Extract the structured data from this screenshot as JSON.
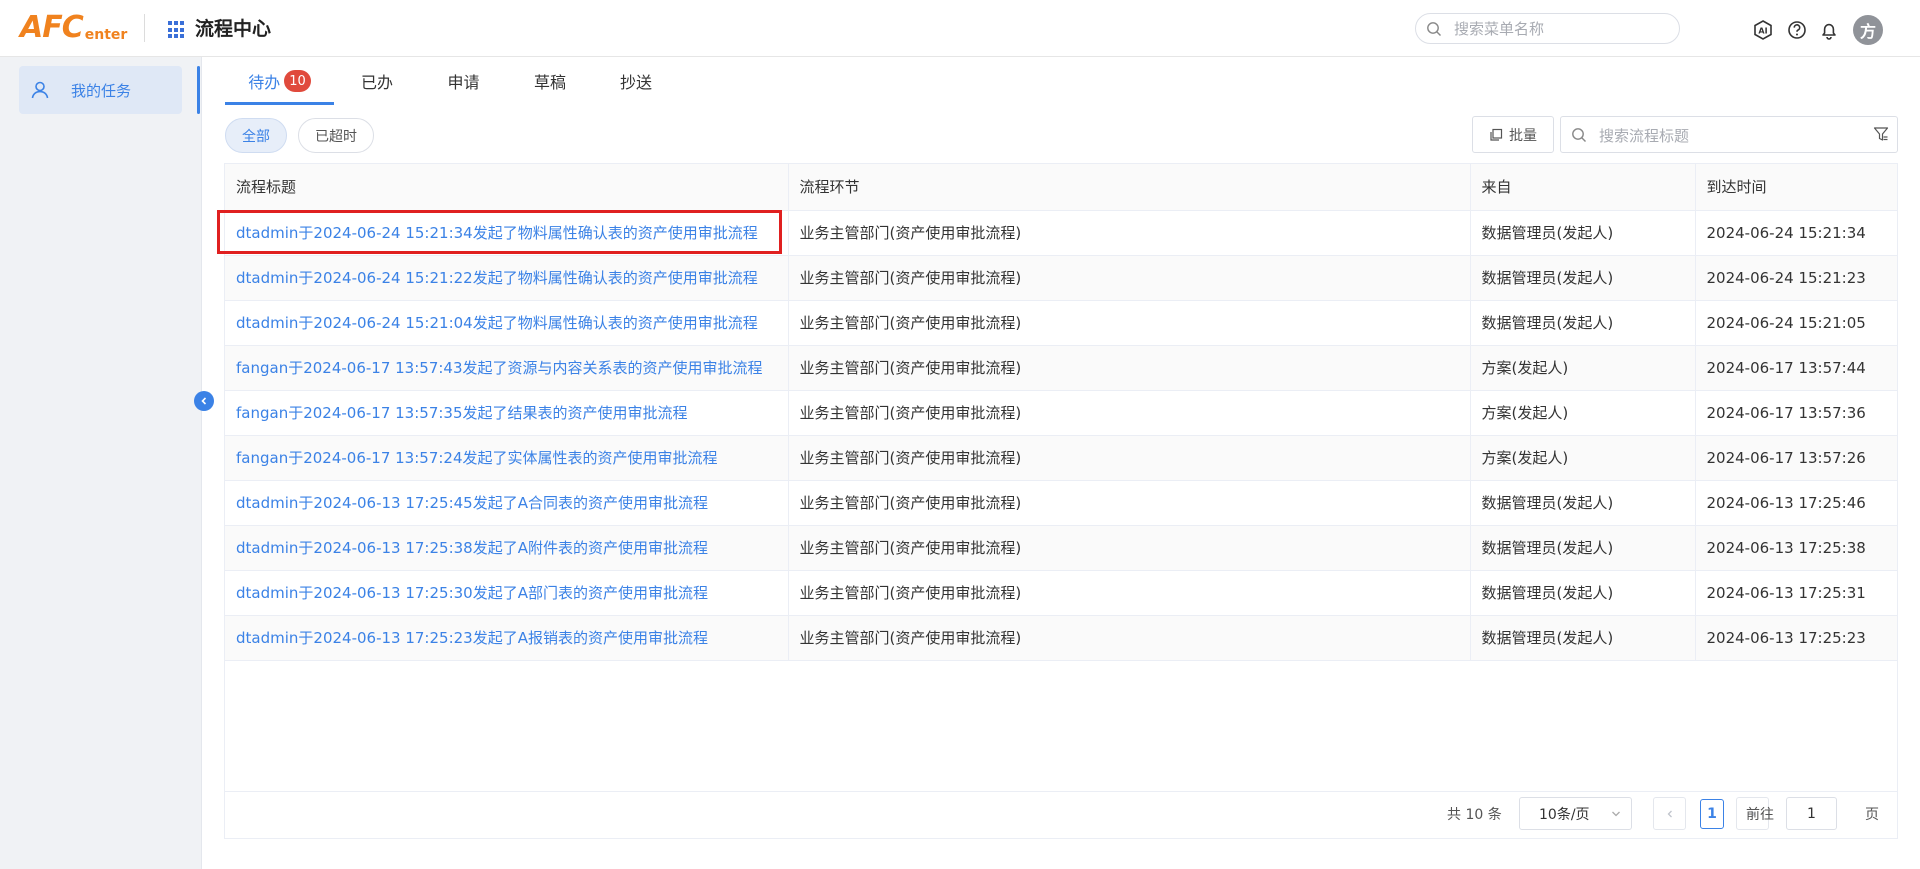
{
  "header": {
    "logo_main": "AFC",
    "logo_sub": "enter",
    "app_title": "流程中心",
    "menu_search_placeholder": "搜索菜单名称",
    "avatar_text": "方"
  },
  "sidebar": {
    "items": [
      {
        "label": "我的任务"
      }
    ]
  },
  "tabs": [
    {
      "label": "待办",
      "badge": "10"
    },
    {
      "label": "已办"
    },
    {
      "label": "申请"
    },
    {
      "label": "草稿"
    },
    {
      "label": "抄送"
    }
  ],
  "filters": {
    "all_label": "全部",
    "overdue_label": "已超时",
    "batch_label": "批量",
    "search_placeholder": "搜索流程标题"
  },
  "table": {
    "columns": [
      "流程标题",
      "流程环节",
      "来自",
      "到达时间"
    ],
    "rows": [
      [
        "dtadmin于2024-06-24 15:21:34发起了物料属性确认表的资产使用审批流程",
        "业务主管部门(资产使用审批流程)",
        "数据管理员(发起人)",
        "2024-06-24 15:21:34"
      ],
      [
        "dtadmin于2024-06-24 15:21:22发起了物料属性确认表的资产使用审批流程",
        "业务主管部门(资产使用审批流程)",
        "数据管理员(发起人)",
        "2024-06-24 15:21:23"
      ],
      [
        "dtadmin于2024-06-24 15:21:04发起了物料属性确认表的资产使用审批流程",
        "业务主管部门(资产使用审批流程)",
        "数据管理员(发起人)",
        "2024-06-24 15:21:05"
      ],
      [
        "fangan于2024-06-17 13:57:43发起了资源与内容关系表的资产使用审批流程",
        "业务主管部门(资产使用审批流程)",
        "方案(发起人)",
        "2024-06-17 13:57:44"
      ],
      [
        "fangan于2024-06-17 13:57:35发起了结果表的资产使用审批流程",
        "业务主管部门(资产使用审批流程)",
        "方案(发起人)",
        "2024-06-17 13:57:36"
      ],
      [
        "fangan于2024-06-17 13:57:24发起了实体属性表的资产使用审批流程",
        "业务主管部门(资产使用审批流程)",
        "方案(发起人)",
        "2024-06-17 13:57:26"
      ],
      [
        "dtadmin于2024-06-13 17:25:45发起了A合同表的资产使用审批流程",
        "业务主管部门(资产使用审批流程)",
        "数据管理员(发起人)",
        "2024-06-13 17:25:46"
      ],
      [
        "dtadmin于2024-06-13 17:25:38发起了A附件表的资产使用审批流程",
        "业务主管部门(资产使用审批流程)",
        "数据管理员(发起人)",
        "2024-06-13 17:25:38"
      ],
      [
        "dtadmin于2024-06-13 17:25:30发起了A部门表的资产使用审批流程",
        "业务主管部门(资产使用审批流程)",
        "数据管理员(发起人)",
        "2024-06-13 17:25:31"
      ],
      [
        "dtadmin于2024-06-13 17:25:23发起了A报销表的资产使用审批流程",
        "业务主管部门(资产使用审批流程)",
        "数据管理员(发起人)",
        "2024-06-13 17:25:23"
      ]
    ]
  },
  "pagination": {
    "total_text": "共 10 条",
    "page_size": "10条/页",
    "current_page": "1",
    "goto_prefix": "前往",
    "goto_value": "1",
    "goto_suffix": "页"
  },
  "colors": {
    "accent": "#3b82e6",
    "logo": "#f0821e",
    "badge": "#e04a3c",
    "highlight": "#e02020"
  },
  "icons": [
    "grid-icon",
    "search-icon",
    "ai-icon",
    "help-icon",
    "bell-icon",
    "user-icon",
    "collapse-icon",
    "copy-icon",
    "filter-icon",
    "chevron-down-icon",
    "chevron-left-icon",
    "chevron-right-icon"
  ]
}
